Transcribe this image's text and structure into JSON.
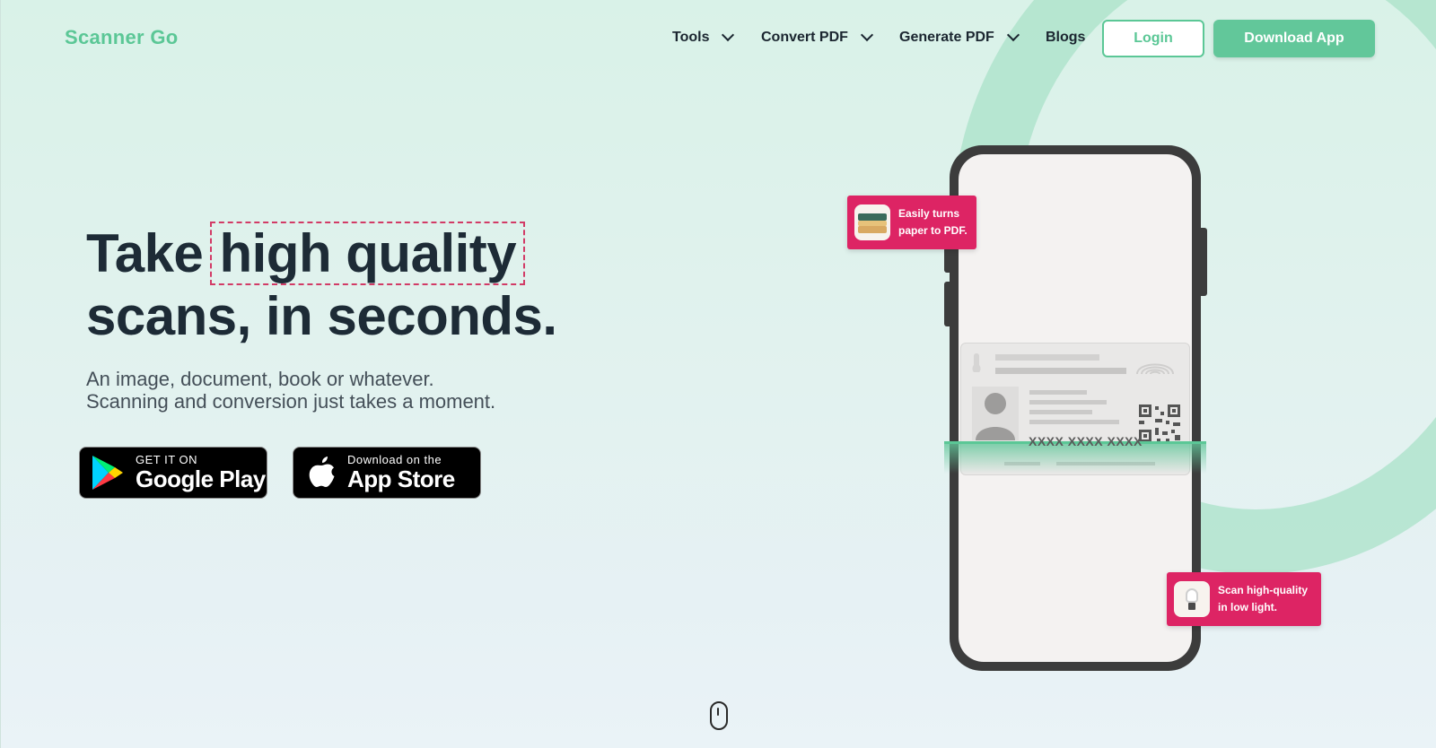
{
  "brand": {
    "name": "Scanner Go",
    "accent": "#5bc796",
    "highlight": "#dd2464"
  },
  "nav": {
    "items": [
      {
        "label": "Tools",
        "has_dropdown": true
      },
      {
        "label": "Convert PDF",
        "has_dropdown": true
      },
      {
        "label": "Generate PDF",
        "has_dropdown": true
      },
      {
        "label": "Blogs",
        "has_dropdown": false
      }
    ],
    "login_label": "Login",
    "download_label": "Download App"
  },
  "hero": {
    "title_prefix": "Take ",
    "title_highlight": "high quality",
    "title_line2": "scans, in seconds.",
    "subtitle_line1": "An image, document, book or whatever.",
    "subtitle_line2": "Scanning and conversion just takes a moment."
  },
  "stores": {
    "google": {
      "small": "GET IT ON",
      "big": "Google Play",
      "icon": "google-play-icon"
    },
    "apple": {
      "small": "Download on the",
      "big": "App Store",
      "icon": "apple-icon"
    }
  },
  "phone": {
    "id_number": "XXXX XXXX XXXX"
  },
  "feature_cards": [
    {
      "line1": "Easily turns",
      "line2": "paper to PDF.",
      "icon": "paper-stack-icon"
    },
    {
      "line1": "Scan high-quality",
      "line2": "in low light.",
      "icon": "lightbulb-icon"
    }
  ],
  "scroll_indicator": {
    "icon": "mouse-scroll-icon"
  }
}
